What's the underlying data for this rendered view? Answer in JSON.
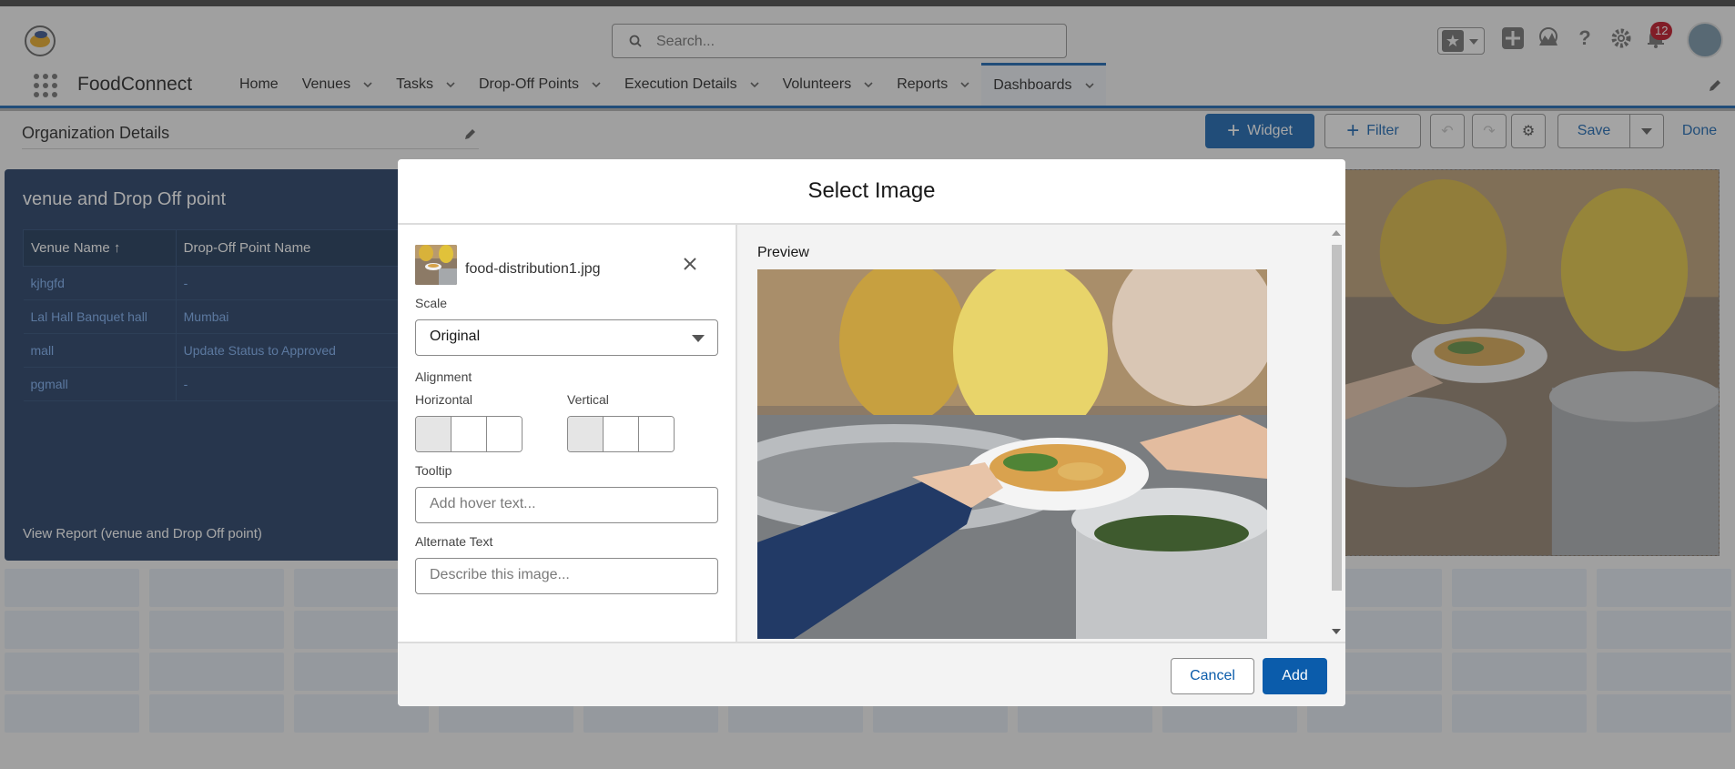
{
  "app": {
    "name": "FoodConnect",
    "search_placeholder": "Search...",
    "notification_count": "12"
  },
  "nav": {
    "items": [
      {
        "label": "Home",
        "has_menu": false
      },
      {
        "label": "Venues",
        "has_menu": true
      },
      {
        "label": "Tasks",
        "has_menu": true
      },
      {
        "label": "Drop-Off Points",
        "has_menu": true
      },
      {
        "label": "Execution Details",
        "has_menu": true
      },
      {
        "label": "Volunteers",
        "has_menu": true
      },
      {
        "label": "Reports",
        "has_menu": true
      },
      {
        "label": "Dashboards",
        "has_menu": true,
        "active": true
      }
    ]
  },
  "dashboard": {
    "title": "Organization Details",
    "widget_label": "Widget",
    "filter_label": "Filter",
    "save_label": "Save",
    "done_label": "Done"
  },
  "report": {
    "title": "venue and Drop Off point",
    "columns": [
      "Venue Name ↑",
      "Drop-Off Point Name"
    ],
    "rows": [
      [
        "kjhgfd",
        "-"
      ],
      [
        "Lal Hall Banquet hall",
        "Mumbai"
      ],
      [
        "mall",
        "Update Status to Approved"
      ],
      [
        "pgmall",
        "-"
      ]
    ],
    "footer_link": "View Report (venue and Drop Off point)"
  },
  "modal": {
    "title": "Select Image",
    "filename": "food-distribution1.jpg",
    "scale_label": "Scale",
    "scale_value": "Original",
    "alignment_label": "Alignment",
    "horizontal_label": "Horizontal",
    "vertical_label": "Vertical",
    "tooltip_label": "Tooltip",
    "tooltip_placeholder": "Add hover text...",
    "alt_label": "Alternate Text",
    "alt_placeholder": "Describe this image...",
    "preview_label": "Preview",
    "cancel_label": "Cancel",
    "add_label": "Add"
  },
  "colors": {
    "brand": "#0b5cab",
    "report_bg": "#16325c",
    "link": "#76aaf0",
    "badge": "#ba0517"
  }
}
